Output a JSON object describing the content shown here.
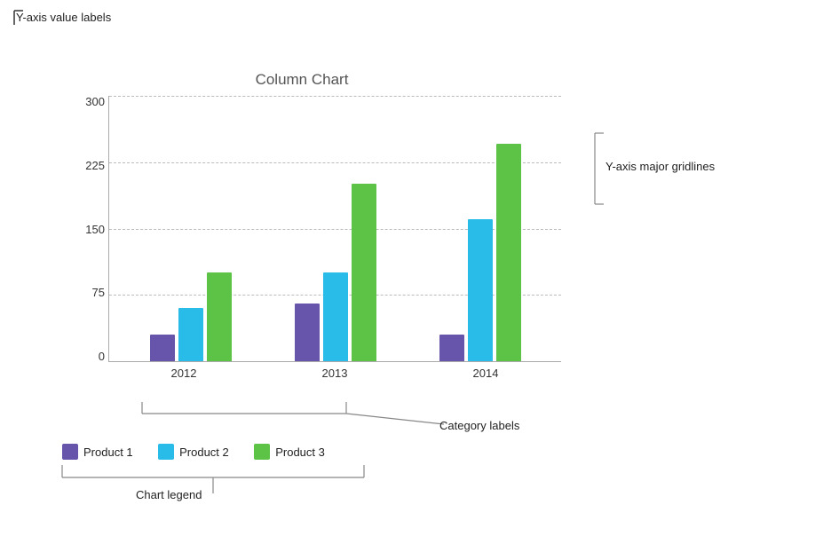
{
  "chart": {
    "title": "Column Chart",
    "y_axis": {
      "labels": [
        "300",
        "225",
        "150",
        "75",
        "0"
      ],
      "max": 300,
      "min": 0
    },
    "x_axis": {
      "categories": [
        "2012",
        "2013",
        "2014"
      ]
    },
    "series": [
      {
        "name": "Product 1",
        "color": "#6655aa",
        "values": [
          30,
          65,
          30
        ]
      },
      {
        "name": "Product 2",
        "color": "#29bce8",
        "values": [
          60,
          100,
          160
        ]
      },
      {
        "name": "Product 3",
        "color": "#5cc346",
        "values": [
          100,
          200,
          245
        ]
      }
    ]
  },
  "annotations": {
    "y_axis_label": "Y-axis value labels",
    "y_axis_gridlines": "Y-axis major gridlines",
    "category_labels": "Category labels",
    "chart_legend": "Chart legend"
  }
}
